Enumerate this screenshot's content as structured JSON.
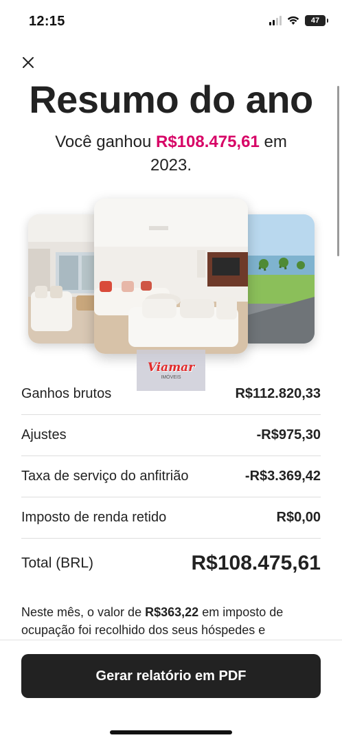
{
  "status_bar": {
    "time": "12:15",
    "battery": "47",
    "icons": [
      "signal-icon",
      "wifi-icon",
      "battery-icon"
    ]
  },
  "header": {
    "close_icon": "close-icon",
    "title": "Resumo do ano",
    "subtitle_prefix": "Você ganhou",
    "subtitle_amount": "R$108.475,61",
    "subtitle_suffix": "em 2023.",
    "accent_color": "#d70466"
  },
  "gallery": {
    "photos": [
      "living-room-photo",
      "living-room-sofa-photo",
      "beach-view-photo"
    ]
  },
  "watermark": {
    "text": "Viamar",
    "subtext": "IMÓVEIS"
  },
  "summary": {
    "rows": [
      {
        "label": "Ganhos brutos",
        "value": "R$112.820,33"
      },
      {
        "label": "Ajustes",
        "value": "-R$975,30"
      },
      {
        "label": "Taxa de serviço do anfitrião",
        "value": "-R$3.369,42"
      },
      {
        "label": "Imposto de renda retido",
        "value": "R$0,00"
      }
    ],
    "total_label": "Total (BRL)",
    "total_value": "R$108.475,61"
  },
  "note": {
    "prefix": "Neste mês, o valor de",
    "amount": "R$363,22",
    "suffix": "em imposto de ocupação foi recolhido dos seus hóspedes e"
  },
  "footer": {
    "button_label": "Gerar relatório em PDF",
    "button_color": "#222222"
  }
}
